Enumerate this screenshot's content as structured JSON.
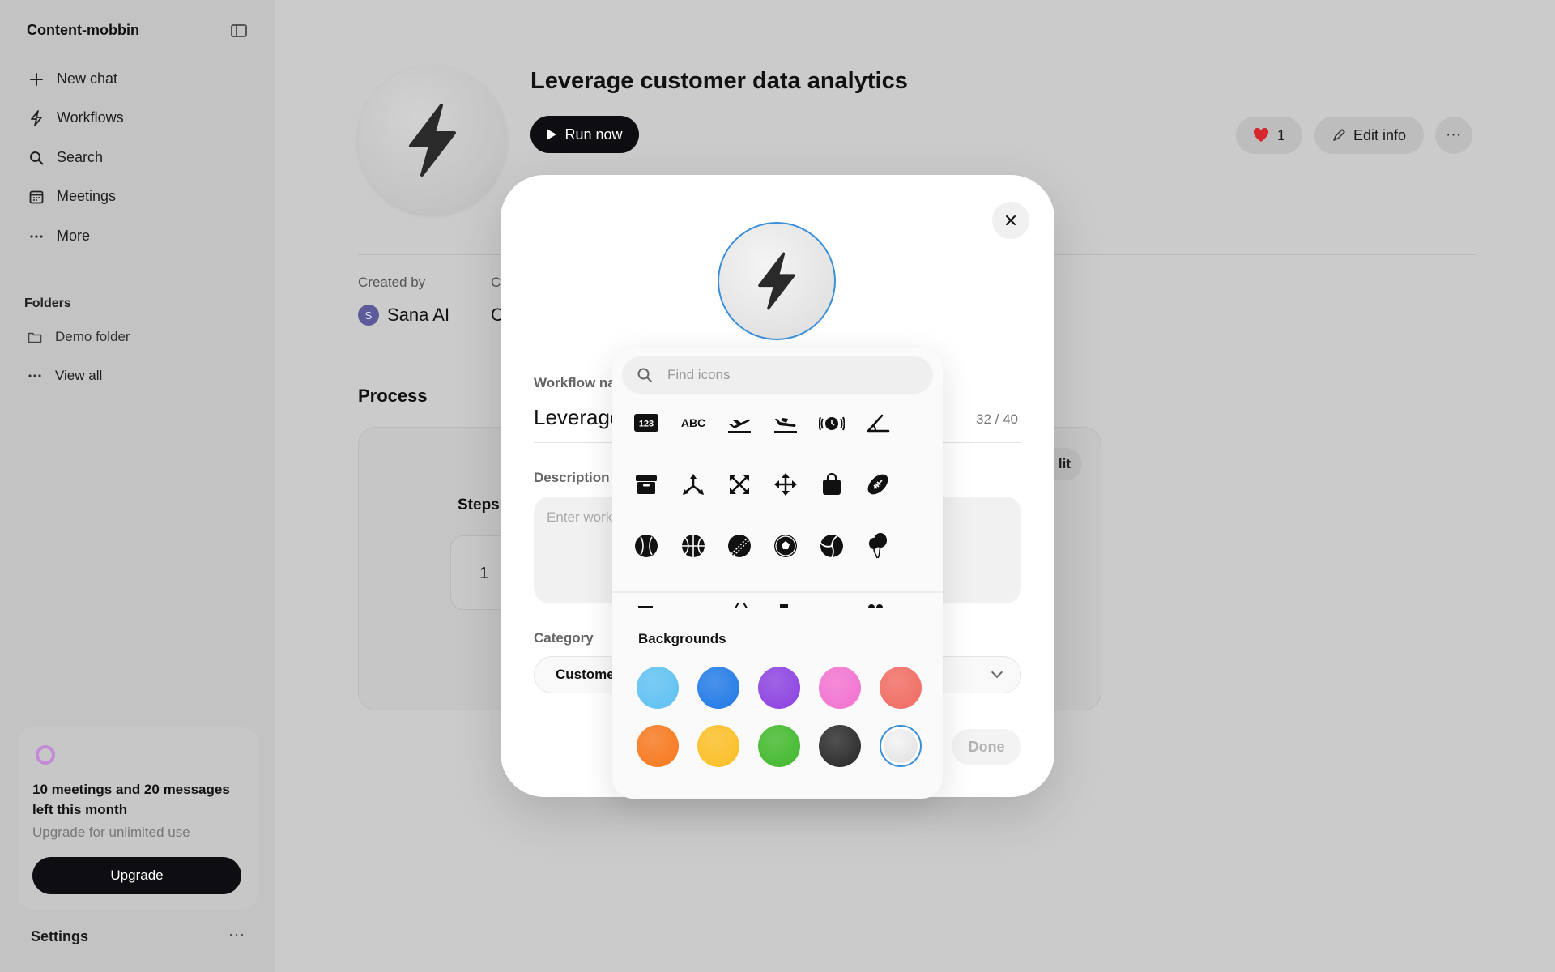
{
  "sidebar": {
    "workspace": "Content-mobbin",
    "nav": [
      {
        "label": "New chat",
        "icon": "plus-icon"
      },
      {
        "label": "Workflows",
        "icon": "bolt-icon"
      },
      {
        "label": "Search",
        "icon": "search-icon"
      },
      {
        "label": "Meetings",
        "icon": "calendar-icon"
      },
      {
        "label": "More",
        "icon": "ellipsis-icon"
      }
    ],
    "folders_label": "Folders",
    "folders": [
      {
        "label": "Demo folder",
        "icon": "folder-icon"
      },
      {
        "label": "View all",
        "icon": "ellipsis-icon"
      }
    ],
    "promo": {
      "title": "10 meetings and 20 messages left this month",
      "subtitle": "Upgrade for unlimited use",
      "button": "Upgrade"
    },
    "settings": "Settings"
  },
  "workflow": {
    "title": "Leverage customer data analytics",
    "run_label": "Run now",
    "likes": "1",
    "edit_label": "Edit info",
    "created_by_label": "Created by",
    "created_second_label": "C",
    "creator_initial": "S",
    "creator_name": "Sana AI",
    "second_value": "C",
    "process_title": "Process",
    "steps_label": "Steps",
    "step_number": "1",
    "edit_chip": "lit"
  },
  "modal": {
    "name_label": "Workflow na",
    "name_value": "Leverage",
    "counter": "32 / 40",
    "description_label": "Description",
    "description_placeholder": "Enter work",
    "category_label": "Category",
    "category_value": "Custome",
    "done_label": "Done"
  },
  "picker": {
    "search_placeholder": "Find icons",
    "icons": [
      "numbers-123-icon",
      "text-abc-icon",
      "airplane-departure-icon",
      "airplane-arrival-icon",
      "alarm-icon",
      "angle-icon",
      "archive-box-icon",
      "arrow-triangle-branch-icon",
      "arrows-expand-icon",
      "arrows-move-icon",
      "bag-icon",
      "american-football-icon",
      "baseball-icon",
      "basketball-icon",
      "cricket-ball-icon",
      "soccer-ball-icon",
      "volleyball-icon",
      "balloons-icon"
    ],
    "icon_text": {
      "num": "123",
      "abc": "ABC"
    },
    "backgrounds_label": "Backgrounds",
    "backgrounds": [
      {
        "name": "light-blue",
        "color": "#5cc0f2"
      },
      {
        "name": "blue",
        "color": "#1e78e6"
      },
      {
        "name": "purple",
        "color": "#8a3fe0"
      },
      {
        "name": "pink",
        "color": "#f270cf"
      },
      {
        "name": "coral",
        "color": "#f06a60"
      },
      {
        "name": "orange",
        "color": "#f7761a"
      },
      {
        "name": "yellow",
        "color": "#fbbe22"
      },
      {
        "name": "green",
        "color": "#3fb829"
      },
      {
        "name": "black",
        "color": "#262626"
      },
      {
        "name": "white",
        "color": "#eeeeee",
        "selected": true
      }
    ]
  }
}
